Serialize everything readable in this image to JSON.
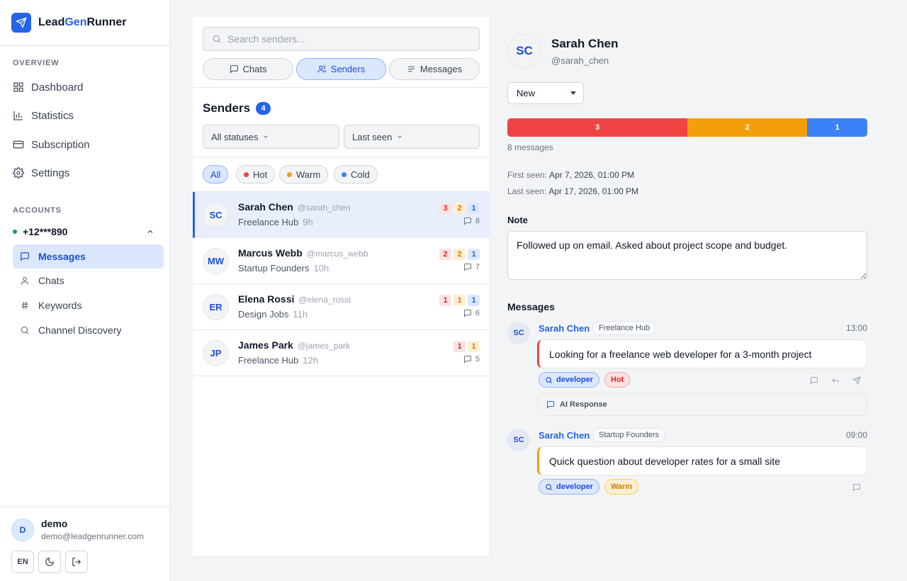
{
  "brand": {
    "name_part1": "Lead",
    "name_part2": "Gen",
    "name_part3": "Runner"
  },
  "sidebar": {
    "overview_label": "OVERVIEW",
    "nav": [
      {
        "label": "Dashboard",
        "icon": "grid-icon"
      },
      {
        "label": "Statistics",
        "icon": "bar-chart-icon"
      },
      {
        "label": "Subscription",
        "icon": "credit-card-icon"
      },
      {
        "label": "Settings",
        "icon": "gear-icon"
      }
    ],
    "accounts_label": "ACCOUNTS",
    "account": {
      "phone": "+12***890",
      "status_color": "#16a34a"
    },
    "account_items": [
      {
        "label": "Messages",
        "icon": "message-icon",
        "active": true
      },
      {
        "label": "Chats",
        "icon": "user-icon"
      },
      {
        "label": "Keywords",
        "icon": "hash-icon"
      },
      {
        "label": "Channel Discovery",
        "icon": "search-icon"
      }
    ],
    "user": {
      "initial": "D",
      "name": "demo",
      "email": "demo@leadgenrunner.com"
    },
    "footer": {
      "lang": "EN"
    }
  },
  "list": {
    "search_placeholder": "Search senders...",
    "tabs": [
      {
        "label": "Chats",
        "icon": "message-icon"
      },
      {
        "label": "Senders",
        "icon": "users-icon",
        "active": true
      },
      {
        "label": "Messages",
        "icon": "lines-icon"
      }
    ],
    "title": "Senders",
    "count": "4",
    "filter_status": "All statuses",
    "filter_sort": "Last seen",
    "chips": [
      {
        "label": "All",
        "active": true
      },
      {
        "label": "Hot",
        "color": "#ef4444"
      },
      {
        "label": "Warm",
        "color": "#f59e0b"
      },
      {
        "label": "Cold",
        "color": "#3b82f6"
      }
    ],
    "senders": [
      {
        "initials": "SC",
        "name": "Sarah Chen",
        "handle": "@sarah_chen",
        "group": "Freelance Hub",
        "ago": "9h",
        "hot": "3",
        "warm": "2",
        "cold": "1",
        "messages": "8"
      },
      {
        "initials": "MW",
        "name": "Marcus Webb",
        "handle": "@marcus_webb",
        "group": "Startup Founders",
        "ago": "10h",
        "hot": "2",
        "warm": "2",
        "cold": "1",
        "messages": "7"
      },
      {
        "initials": "ER",
        "name": "Elena Rossi",
        "handle": "@elena_rossi",
        "group": "Design Jobs",
        "ago": "11h",
        "hot": "1",
        "warm": "1",
        "cold": "1",
        "messages": "6"
      },
      {
        "initials": "JP",
        "name": "James Park",
        "handle": "@james_park",
        "group": "Freelance Hub",
        "ago": "12h",
        "hot": "1",
        "warm": "1",
        "messages": "5"
      }
    ]
  },
  "detail": {
    "initials": "SC",
    "name": "Sarah Chen",
    "handle": "@sarah_chen",
    "status": "New",
    "distribution": {
      "hot": 3,
      "warm": 2,
      "cold": 1,
      "hot_label": "3",
      "warm_label": "2",
      "cold_label": "1",
      "colors": {
        "hot": "#ef4444",
        "warm": "#f59e0b",
        "cold": "#3b82f6"
      }
    },
    "messages_total": "8 messages",
    "first_seen_label": "First seen:",
    "first_seen": "Apr 7, 2026, 01:00 PM",
    "last_seen_label": "Last seen:",
    "last_seen": "Apr 17, 2026, 01:00 PM",
    "note_label": "Note",
    "note": "Followed up on email. Asked about project scope and budget.",
    "messages_label": "Messages",
    "messages": [
      {
        "initials": "SC",
        "sender": "Sarah Chen",
        "group": "Freelance Hub",
        "time": "13:00",
        "text": "Looking for a freelance web developer for a 3-month project",
        "keyword": "developer",
        "status": "Hot",
        "ai_label": "AI Response"
      },
      {
        "initials": "SC",
        "sender": "Sarah Chen",
        "group": "Startup Founders",
        "time": "09:00",
        "text": "Quick question about developer rates for a small site",
        "keyword": "developer",
        "status": "Warm"
      }
    ]
  }
}
